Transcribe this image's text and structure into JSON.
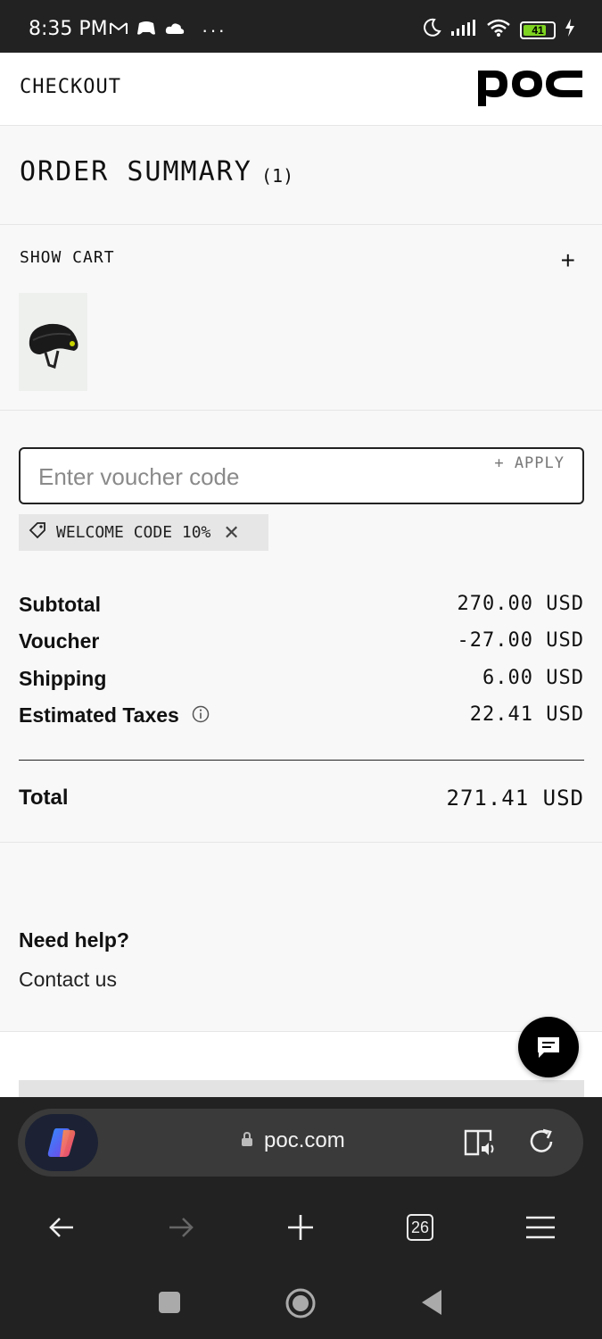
{
  "status_bar": {
    "time": "8:35 PM",
    "battery": "41",
    "icons_left": [
      "gmail-icon",
      "game-icon",
      "cloud-icon",
      "more-icon"
    ],
    "icons_right": [
      "moon-icon",
      "signal-icon",
      "wifi-icon",
      "battery-icon",
      "charging-icon"
    ]
  },
  "header": {
    "title": "CHECKOUT",
    "logo_text": "poc"
  },
  "order_summary": {
    "title": "ORDER SUMMARY",
    "count": "(1)"
  },
  "cart": {
    "label": "SHOW CART",
    "toggle": "+"
  },
  "voucher": {
    "placeholder": "Enter voucher code",
    "apply_label": "+ APPLY",
    "applied_code": "WELCOME CODE 10%"
  },
  "totals": {
    "subtotal_label": "Subtotal",
    "subtotal_value": "270.00 USD",
    "voucher_label": "Voucher",
    "voucher_value": "-27.00 USD",
    "shipping_label": "Shipping",
    "shipping_value": "6.00 USD",
    "taxes_label": "Estimated Taxes",
    "taxes_value": "22.41 USD",
    "total_label": "Total",
    "total_value": "271.41 USD"
  },
  "help": {
    "title": "Need help?",
    "link": "Contact us"
  },
  "browser": {
    "url": "poc.com",
    "tab_count": "26"
  },
  "colors": {
    "status_bg": "#222222",
    "page_bg": "#f8f8f8",
    "battery_fill": "#7ed321"
  }
}
